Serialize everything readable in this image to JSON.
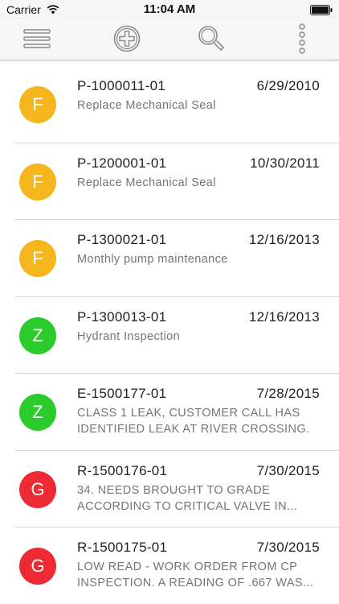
{
  "status_bar": {
    "carrier": "Carrier",
    "time": "11:04 AM"
  },
  "toolbar": {
    "menu_icon": "hamburger-icon",
    "add_icon": "add-circle-icon",
    "search_icon": "search-icon",
    "more_icon": "more-vertical-icon"
  },
  "colors": {
    "F": "#f5b51c",
    "Z": "#2ccb2c",
    "G": "#ee2a34",
    "divider": "#d9d9d9"
  },
  "work_orders": [
    {
      "letter": "F",
      "color": "#f5b51c",
      "id": "P-1000011-01",
      "date": "6/29/2010",
      "line1": "Replace Mechanical Seal",
      "line2": ""
    },
    {
      "letter": "F",
      "color": "#f5b51c",
      "id": "P-1200001-01",
      "date": "10/30/2011",
      "line1": "Replace Mechanical Seal",
      "line2": ""
    },
    {
      "letter": "F",
      "color": "#f5b51c",
      "id": "P-1300021-01",
      "date": "12/16/2013",
      "line1": "Monthly pump maintenance",
      "line2": ""
    },
    {
      "letter": "Z",
      "color": "#2ccb2c",
      "id": "P-1300013-01",
      "date": "12/16/2013",
      "line1": "Hydrant Inspection",
      "line2": ""
    },
    {
      "letter": "Z",
      "color": "#2ccb2c",
      "id": "E-1500177-01",
      "date": "7/28/2015",
      "line1": "CLASS 1 LEAK, CUSTOMER CALL HAS",
      "line2": "IDENTIFIED LEAK AT RIVER CROSSING."
    },
    {
      "letter": "G",
      "color": "#ee2a34",
      "id": "R-1500176-01",
      "date": "7/30/2015",
      "line1": "34. NEEDS BROUGHT TO GRADE",
      "line2": "ACCORDING TO CRITICAL VALVE IN..."
    },
    {
      "letter": "G",
      "color": "#ee2a34",
      "id": "R-1500175-01",
      "date": "7/30/2015",
      "line1": "LOW READ - WORK ORDER FROM CP",
      "line2": "INSPECTION. A READING OF .667 WAS..."
    }
  ]
}
